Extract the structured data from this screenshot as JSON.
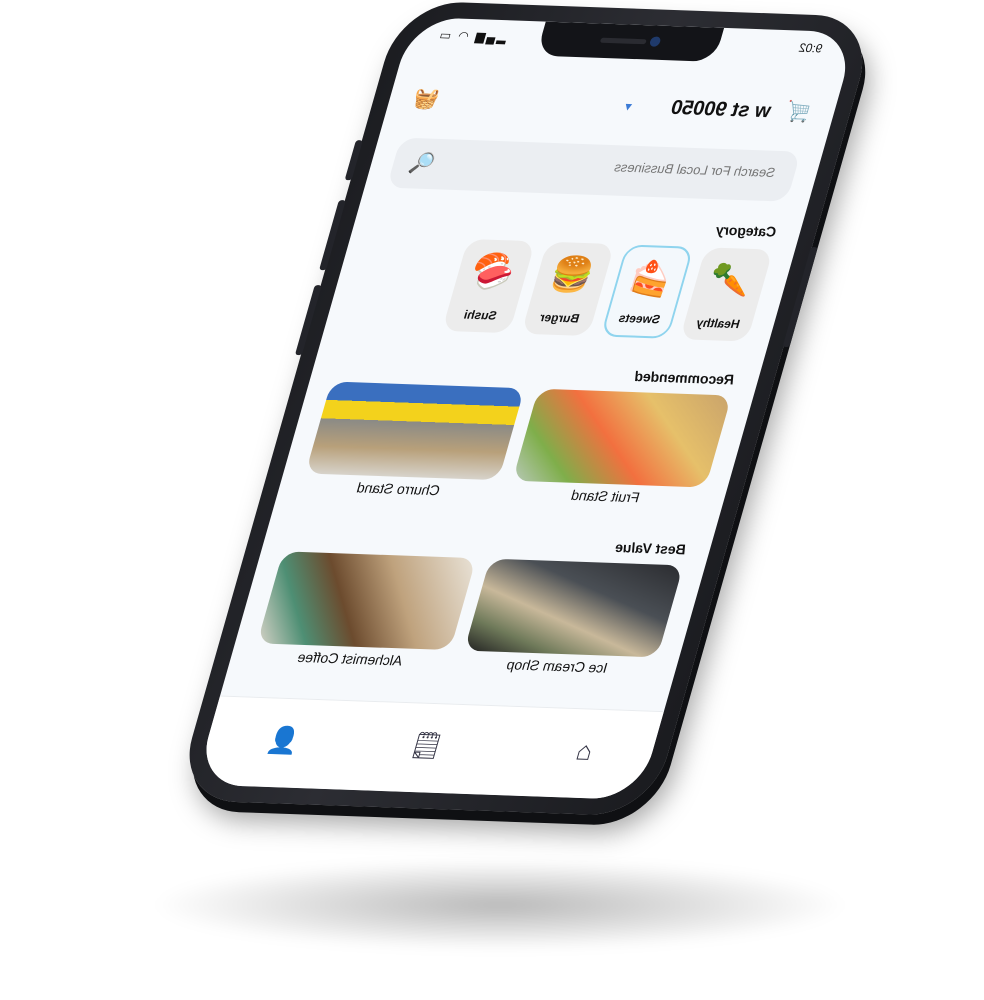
{
  "status": {
    "time": "9:02",
    "icons": "▂▄▆ ◠ ▭"
  },
  "header": {
    "address": "w st 90050",
    "cart_icon": "🛒",
    "basket_icon": "🧺"
  },
  "search": {
    "placeholder": "Search For Local Bussiness",
    "icon": "🔍"
  },
  "sections": {
    "category": "Category",
    "recommended": "Recommended",
    "best_value": "Best Value"
  },
  "categories": [
    {
      "label": "Healthy",
      "icon": "🥕"
    },
    {
      "label": "Sweets",
      "icon": "🍰",
      "active": true
    },
    {
      "label": "Burger",
      "icon": "🍔"
    },
    {
      "label": "Sushi",
      "icon": "🍣"
    }
  ],
  "recommended": [
    {
      "name": "Fruit Stand"
    },
    {
      "name": "Churro Stand"
    }
  ],
  "best_value": [
    {
      "name": "Ice Cream Shop"
    },
    {
      "name": "Alchemist Coffee"
    }
  ],
  "tabbar": {
    "home_icon": "⌂",
    "orders_icon": "🗒",
    "profile_icon": "👤"
  },
  "colors": {
    "accent": "#8fd4ee",
    "screen_bg": "#f6f9fc",
    "frame": "#1f2025"
  }
}
